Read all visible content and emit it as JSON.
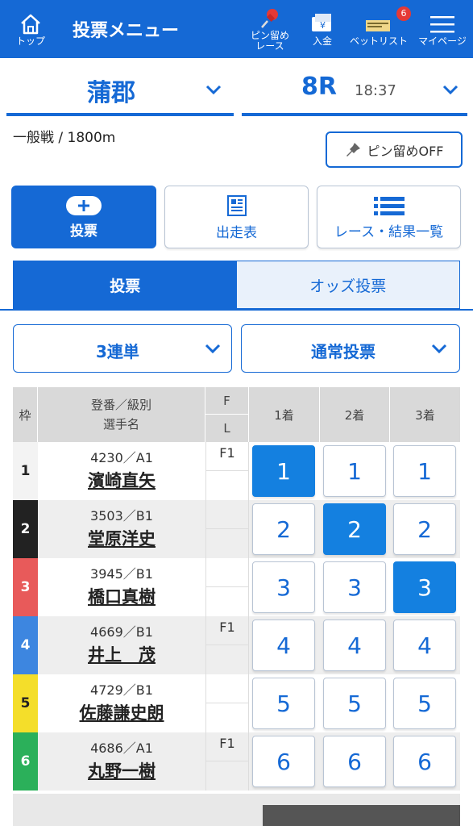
{
  "header": {
    "home_label": "トップ",
    "title": "投票メニュー",
    "pin_label": "ピン留め\nレース",
    "deposit_label": "入金",
    "bet_list_label": "ベットリスト",
    "bet_list_badge": "6",
    "mypage_label": "マイページ"
  },
  "race": {
    "venue": "蒲郡",
    "race_number": "8R",
    "time": "18:37",
    "info": "一般戦 / 1800m",
    "pin_toggle": "ピン留めOFF"
  },
  "tiles": {
    "bet": "投票",
    "entry_list": "出走表",
    "results": "レース・結果一覧"
  },
  "tabs": {
    "bet": "投票",
    "odds_bet": "オッズ投票"
  },
  "selects": {
    "bet_type": "3連単",
    "bet_method": "通常投票"
  },
  "table": {
    "headers": {
      "waku": "枠",
      "racer": "登番／級別\n選手名",
      "f": "F",
      "l": "L",
      "first": "1着",
      "second": "2着",
      "third": "3着"
    },
    "rows": [
      {
        "waku": "1",
        "reg": "4230／A1",
        "name": "濱崎直矢",
        "f": "F1",
        "l": "",
        "color": "#ffffff",
        "text_color": "#222222",
        "sel": [
          true,
          false,
          false
        ]
      },
      {
        "waku": "2",
        "reg": "3503／B1",
        "name": "堂原洋史",
        "f": "",
        "l": "",
        "color": "#222222",
        "text_color": "#ffffff",
        "sel": [
          false,
          true,
          false
        ]
      },
      {
        "waku": "3",
        "reg": "3945／B1",
        "name": "橋口真樹",
        "f": "",
        "l": "",
        "color": "#e85a5a",
        "text_color": "#ffffff",
        "sel": [
          false,
          false,
          true
        ]
      },
      {
        "waku": "4",
        "reg": "4669／B1",
        "name": "井上　茂",
        "f": "F1",
        "l": "",
        "color": "#3d86e0",
        "text_color": "#ffffff",
        "sel": [
          false,
          false,
          false
        ]
      },
      {
        "waku": "5",
        "reg": "4729／B1",
        "name": "佐藤謙史朗",
        "f": "",
        "l": "",
        "color": "#f4de2a",
        "text_color": "#222222",
        "sel": [
          false,
          false,
          false
        ]
      },
      {
        "waku": "6",
        "reg": "4686／A1",
        "name": "丸野一樹",
        "f": "F1",
        "l": "",
        "color": "#2bb05a",
        "text_color": "#ffffff",
        "sel": [
          false,
          false,
          false
        ]
      }
    ]
  },
  "colors": {
    "brand": "#1569d5",
    "selected": "#1480e0"
  }
}
